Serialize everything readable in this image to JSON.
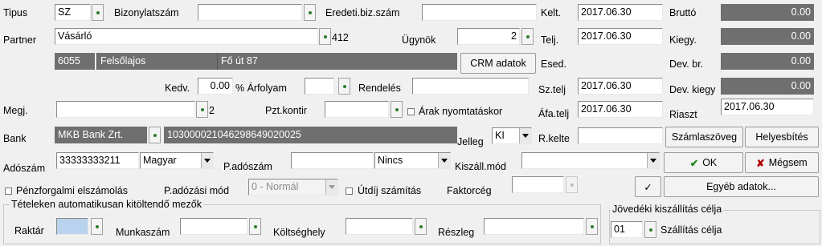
{
  "labels": {
    "tipus": "Tipus",
    "bizonylatszam": "Bizonylatszám",
    "eredeti": "Eredeti.biz.szám",
    "kelt": "Kelt.",
    "brutto": "Bruttó",
    "partner": "Partner",
    "partner_code": "412",
    "ugynok": "Ügynök",
    "telj": "Telj.",
    "kiegy": "Kiegy.",
    "esed": "Esed.",
    "devbr": "Dev. br.",
    "kedv": "Kedv.",
    "arfolyam": "% Árfolyam",
    "rendeles": "Rendelés",
    "szteljj": "Sz.telj",
    "devkiegy": "Dev. kiegy",
    "megj": "Megj.",
    "megj_count": "2",
    "pztkontir": "Pzt.kontir",
    "arak": "Árak nyomtatáskor",
    "afatelj": "Áfa.telj",
    "riaszt": "Riaszt",
    "bank": "Bank",
    "jelleg": "Jelleg",
    "rkelte": "R.kelte",
    "adoszam": "Adószám",
    "padoszam": "P.adószám",
    "kiszallmod": "Kiszáll.mód",
    "penzforgalmi": "Pénzforgalmi elszámolás",
    "padozasimod": "P.adózási mód",
    "utdij": "Útdíj számítás",
    "faktorceg": "Faktorcég",
    "group_title": "Tételeken automatikusan kitöltendő mezők",
    "raktar": "Raktár",
    "munkaszam": "Munkaszám",
    "koltseghely": "Költséghely",
    "reszleg": "Részleg",
    "jovedeki": "Jövedéki kiszállítás célja",
    "szallitas_celja": "Szállítás célja"
  },
  "values": {
    "tipus": "SZ",
    "bizonylatszam": "",
    "eredeti": "",
    "kelt": "2017.06.30",
    "brutto": "0.00",
    "partner": "Vásárló",
    "ugynok": "2",
    "telj": "2017.06.30",
    "kiegy": "0.00",
    "zip": "6055",
    "city": "Felsőlajos",
    "street": "Fő út 87",
    "devbr": "0.00",
    "kedv": "0.00",
    "arfolyam": "",
    "rendeles": "",
    "szteljj": "2017.06.30",
    "devkiegy": "0.00",
    "megj": "",
    "pztkontir": "",
    "afatelj": "2017.06.30",
    "riaszt": "2017.06.30",
    "bank_name": "MKB Bank Zrt.",
    "bank_account": "103000021046298649020025",
    "jelleg": "KI",
    "rkelte": "",
    "adoszam": "33333333211",
    "nyelv": "Magyar",
    "padoszam": "",
    "nincs": "Nincs",
    "kiszallmod": "",
    "padozasimod": "0 - Normál",
    "faktorceg": "",
    "raktar": "",
    "munkaszam": "",
    "koltseghely": "",
    "reszleg": "",
    "jovedeki_code": "01"
  },
  "buttons": {
    "crm": "CRM adatok",
    "szamlaszoveg": "Számlaszöveg",
    "helyesbites": "Helyesbítés",
    "ok": "OK",
    "megsem": "Mégsem",
    "egyeb": "Egyéb adatok...",
    "check_icon": "✔"
  },
  "colors": {
    "readonly": "#6f6f6f",
    "raktar_fill": "#b9d3ee",
    "ok_green": "#1e8a1e",
    "cancel_red": "#b00000"
  }
}
